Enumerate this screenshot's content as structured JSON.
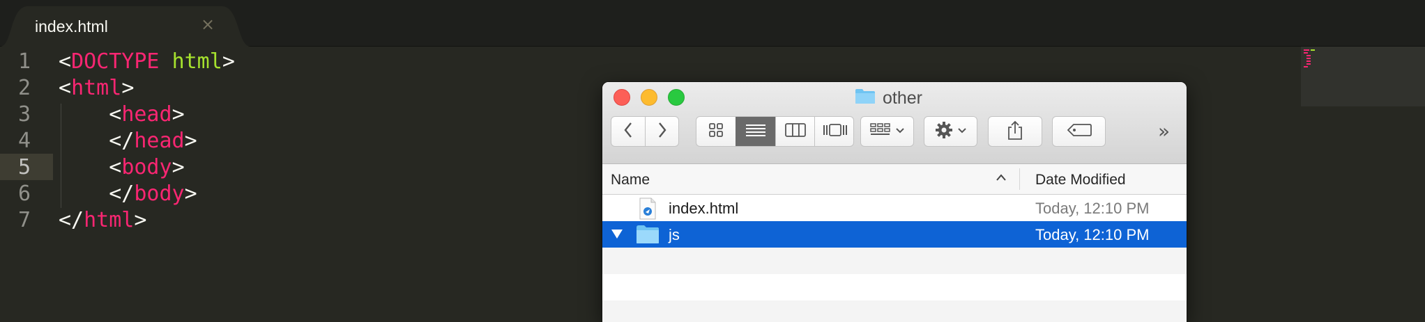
{
  "editor": {
    "tab": {
      "title": "index.html",
      "close_glyph": "×"
    },
    "lines": [
      {
        "num": "1",
        "parts": [
          {
            "t": "<",
            "c": "plain"
          },
          {
            "t": "DOCTYPE",
            "c": "tag"
          },
          {
            "t": " ",
            "c": "plain"
          },
          {
            "t": "html",
            "c": "kw"
          },
          {
            "t": ">",
            "c": "plain"
          }
        ]
      },
      {
        "num": "2",
        "parts": [
          {
            "t": "<",
            "c": "plain"
          },
          {
            "t": "html",
            "c": "tag"
          },
          {
            "t": ">",
            "c": "plain"
          }
        ]
      },
      {
        "num": "3",
        "parts": [
          {
            "t": "    <",
            "c": "plain"
          },
          {
            "t": "head",
            "c": "tag"
          },
          {
            "t": ">",
            "c": "plain"
          }
        ]
      },
      {
        "num": "4",
        "parts": [
          {
            "t": "    </",
            "c": "plain"
          },
          {
            "t": "head",
            "c": "tag"
          },
          {
            "t": ">",
            "c": "plain"
          }
        ]
      },
      {
        "num": "5",
        "parts": [
          {
            "t": "    <",
            "c": "plain"
          },
          {
            "t": "body",
            "c": "tag"
          },
          {
            "t": ">",
            "c": "plain"
          }
        ]
      },
      {
        "num": "6",
        "parts": [
          {
            "t": "    </",
            "c": "plain"
          },
          {
            "t": "body",
            "c": "tag"
          },
          {
            "t": ">",
            "c": "plain"
          }
        ]
      },
      {
        "num": "7",
        "parts": [
          {
            "t": "</",
            "c": "plain"
          },
          {
            "t": "html",
            "c": "tag"
          },
          {
            "t": ">",
            "c": "plain"
          }
        ]
      }
    ],
    "current_line": 5
  },
  "finder": {
    "title": "other",
    "toolbar": {
      "back_icon": "chevron-left-icon",
      "forward_icon": "chevron-right-icon",
      "view_modes": [
        "icon-view-icon",
        "list-view-icon",
        "column-view-icon",
        "cover-flow-icon"
      ],
      "selected_view": "list-view-icon",
      "overflow_glyph": "»"
    },
    "columns": {
      "name": "Name",
      "date_modified": "Date Modified"
    },
    "files": [
      {
        "name": "index.html",
        "date": "Today, 12:10 PM",
        "kind": "html-file",
        "selected": false
      },
      {
        "name": "js",
        "date": "Today, 12:10 PM",
        "kind": "folder",
        "selected": true,
        "expanded": true
      }
    ]
  },
  "colors": {
    "editor_bg": "#272822",
    "tag": "#f92672",
    "keyword": "#a6e22e",
    "selection": "#0e63d5"
  }
}
